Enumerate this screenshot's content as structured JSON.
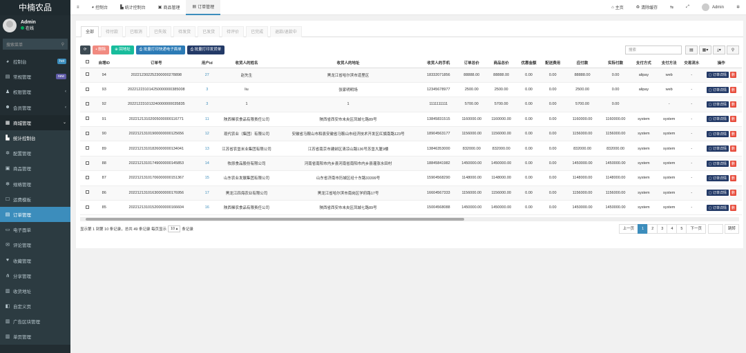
{
  "app": {
    "title": "中楠农品",
    "user": "Admin",
    "status": "在线",
    "search_placeholder": "搜索菜单"
  },
  "menu": [
    {
      "icon": "dashboard-icon",
      "glyph": "◕",
      "label": "控制台",
      "badge": "hot",
      "badge_color": "#3c8dbc",
      "type": "top"
    },
    {
      "icon": "list-icon",
      "glyph": "▤",
      "label": "常规管理",
      "badge": "new",
      "badge_color": "#605ca8",
      "type": "top"
    },
    {
      "icon": "group-icon",
      "glyph": "♟",
      "label": "权限管理",
      "arrow": "‹",
      "type": "top"
    },
    {
      "icon": "user-icon",
      "glyph": "☻",
      "label": "会员管理",
      "arrow": "‹",
      "type": "top"
    },
    {
      "icon": "shop-icon",
      "glyph": "▦",
      "label": "商城管理",
      "arrow": "⌄",
      "type": "open"
    },
    {
      "icon": "chart-icon",
      "glyph": "▙",
      "label": "统计控制台",
      "type": "sub-bright"
    },
    {
      "icon": "gear-icon",
      "glyph": "✲",
      "label": "配置管理",
      "type": "sub"
    },
    {
      "icon": "goods-icon",
      "glyph": "▣",
      "label": "商品管理",
      "type": "sub"
    },
    {
      "icon": "star-icon",
      "glyph": "✻",
      "label": "规格管理",
      "type": "sub"
    },
    {
      "icon": "template-icon",
      "glyph": "☐",
      "label": "运费模板",
      "type": "sub"
    },
    {
      "icon": "order-icon",
      "glyph": "▤",
      "label": "订单管理",
      "type": "active"
    },
    {
      "icon": "eorder-icon",
      "glyph": "▭",
      "label": "电子面单",
      "type": "sub"
    },
    {
      "icon": "comment-icon",
      "glyph": "✉",
      "label": "评论管理",
      "type": "sub"
    },
    {
      "icon": "heart-icon",
      "glyph": "♥",
      "label": "收藏管理",
      "type": "sub"
    },
    {
      "icon": "share-icon",
      "glyph": "⋔",
      "label": "分享管理",
      "type": "sub"
    },
    {
      "icon": "address-icon",
      "glyph": "▥",
      "label": "收货地址",
      "type": "sub"
    },
    {
      "icon": "page-icon",
      "glyph": "◧",
      "label": "自定义页",
      "type": "sub"
    },
    {
      "icon": "ad-icon",
      "glyph": "▥",
      "label": "广告区块管理",
      "type": "sub"
    },
    {
      "icon": "nav-icon",
      "glyph": "▥",
      "label": "单页管理",
      "type": "sub"
    }
  ],
  "topnav": {
    "tabs": [
      {
        "icon": "dashboard-icon",
        "glyph": "◕",
        "label": "控制台"
      },
      {
        "icon": "chart-icon",
        "glyph": "▙",
        "label": "统计控制台"
      },
      {
        "icon": "goods-icon",
        "glyph": "▣",
        "label": "商品管理"
      },
      {
        "icon": "order-icon",
        "glyph": "▤",
        "label": "订单管理",
        "active": true
      }
    ],
    "home": "主页",
    "clear": "清除缓存",
    "user": "Admin"
  },
  "status_tabs": [
    "全部",
    "待付款",
    "已取消",
    "已失效",
    "待发货",
    "已发货",
    "待评价",
    "已完成",
    "退款/退款中"
  ],
  "toolbar": {
    "refresh": "⟳",
    "delete": "删除",
    "callback": "回地址",
    "print_express": "批量打印快递电子面单",
    "print_ship": "批量打印发货单",
    "search_placeholder": "搜索"
  },
  "table": {
    "columns": [
      "",
      "自增ID",
      "订单号",
      "用户id",
      "收货人的姓名",
      "收货人的地址",
      "收货人的手机",
      "订单总价",
      "商品总价",
      "优惠金额",
      "配送费用",
      "应付款",
      "实际付款",
      "支付方式",
      "支付方法",
      "交易流水",
      "操作"
    ],
    "detail_label": "订单详情",
    "delete_label": "删",
    "rows": [
      [
        "94",
        "202212302252300000278898",
        "27",
        "赵先生",
        "黑龙江省哈尔滨市道里区",
        "18332071856",
        "88888.00",
        "88888.00",
        "0.00",
        "0.00",
        "88888.00",
        "0.00",
        "alipay",
        "web",
        "-"
      ],
      [
        "93",
        "202212231014250000000385008",
        "3",
        "liu",
        "张家明明场",
        "12345678977",
        "2500.00",
        "2500.00",
        "0.00",
        "0.00",
        "2500.00",
        "0.00",
        "alipay",
        "web",
        "-"
      ],
      [
        "92",
        "202212231013240000000035835",
        "3",
        "1",
        "1",
        "1111111111",
        "5700.00",
        "5700.00",
        "0.00",
        "0.00",
        "5700.00",
        "0.00",
        "",
        "-",
        "-"
      ],
      [
        "91",
        "20221213102005000000116771",
        "11",
        "陕西稀农食品有限责任公司",
        "陕西省西安市未央区凤城七路89号",
        "13845831515",
        "1160000.00",
        "1160000.00",
        "0.00",
        "0.00",
        "1160000.00",
        "1160000.00",
        "system",
        "system",
        "-"
      ],
      [
        "90",
        "20221213101900000000125656",
        "12",
        "现代农业（集团）有限公司",
        "安徽省马鞍山市和县安徽省马鞍山市经济技术开发区红旗南路123号",
        "18904563177",
        "1156000.00",
        "1156000.00",
        "0.00",
        "0.00",
        "1156000.00",
        "1156000.00",
        "system",
        "system",
        "-"
      ],
      [
        "89",
        "20221213101826000000134041",
        "13",
        "江苏省农垦米业集团有限公司",
        "江苏省南京市建邺区清凉山路136号苏垦大厦9楼",
        "13846353000",
        "832000.00",
        "832000.00",
        "0.00",
        "0.00",
        "832000.00",
        "832000.00",
        "system",
        "system",
        "-"
      ],
      [
        "88",
        "20221213101749000000145853",
        "14",
        "牧原食品股份有限公司",
        "河南省南阳市内乡县河南省南阳市内乡县灌涨水田村",
        "18845841982",
        "1450000.00",
        "1450000.00",
        "0.00",
        "0.00",
        "1450000.00",
        "1450000.00",
        "system",
        "system",
        "-"
      ],
      [
        "87",
        "20221213101706000000151367",
        "15",
        "山东农业发展集团有限公司",
        "山东省济南市历城区经十东路33399号",
        "15904568290",
        "1148000.00",
        "1148000.00",
        "0.00",
        "0.00",
        "1148000.00",
        "1148000.00",
        "system",
        "system",
        "-"
      ],
      [
        "86",
        "20221213101630000000176956",
        "17",
        "黑龙江四海农业有限公司",
        "黑龙江省哈尔滨市南岗区学府路17号",
        "16604567333",
        "1156000.00",
        "1156000.00",
        "0.00",
        "0.00",
        "1156000.00",
        "1156000.00",
        "system",
        "system",
        "-"
      ],
      [
        "85",
        "20221213101520000000166604",
        "16",
        "陕西稀农食品有限责任公司",
        "陕西省西安市未央区凤城七路89号",
        "15004568088",
        "1450000.00",
        "1450000.00",
        "0.00",
        "0.00",
        "1450000.00",
        "1450000.00",
        "system",
        "system",
        "-"
      ]
    ]
  },
  "footer": {
    "summary_pre": "显示第 1 到第 10 条记录，总共 49 条记录 每页显示",
    "page_size": "10 ▴",
    "summary_post": "条记录",
    "prev": "上一页",
    "pages": [
      "1",
      "2",
      "3",
      "4",
      "5"
    ],
    "current_page": "1",
    "next": "下一页",
    "jump": "跳转"
  }
}
